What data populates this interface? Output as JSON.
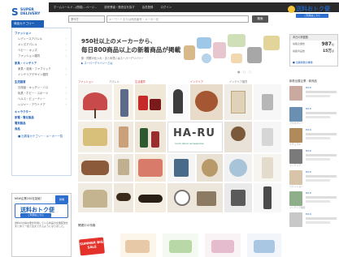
{
  "header": {
    "logo_mark": "S",
    "logo_line1": "SUPER",
    "logo_line2": "DELIVERY",
    "top_links": [
      "ホームシールド…(簡易)…ページ…",
      "卸売業者・販売店を探す",
      "会員登録",
      "ログイン"
    ],
    "search_select": "すべて",
    "search_placeholder": "キーワードまたは商品番号・メーカー名",
    "search_button": "検索"
  },
  "sidebar": {
    "header": "商品カテゴリー",
    "sections": [
      {
        "title": "ファッション",
        "items": [
          "レディースアパレル",
          "メンズアパレル",
          "ベビー・キッズ",
          "ファッション雑貨"
        ]
      },
      {
        "title": "家具・インテリア",
        "items": [
          "家具・収納・ファブリック",
          "インテリアデザイン雑貨"
        ]
      },
      {
        "title": "生活雑貨",
        "items": [
          "日用品・キッチン・バス",
          "玩具・ホビー・スポーツ",
          "ヘルス・ビューティー",
          "レジャー・アウトドア"
        ]
      },
      {
        "title": "キャラクター",
        "items": []
      },
      {
        "title": "家電・電化製品",
        "items": []
      },
      {
        "title": "電気製品",
        "items": []
      },
      {
        "title": "食品",
        "items": []
      }
    ],
    "footer_link": "出展者カテゴリー・メーカー一覧"
  },
  "promo": {
    "title": "NEW企業200社突破！",
    "badge": "新規",
    "logo_text": "送料おトク便",
    "logo_sub": "ご利用はこちら",
    "body": "送料のお得な便を利用している商品の全国配送をまとめて一括で注文できるようになりました。"
  },
  "hero": {
    "headline1": "950社以上のメーカーから、",
    "headline2": "毎日800商品以上の新着商品が掲載",
    "sub": "卸・問屋の仕入れ・まとめ買いはスーパーデリバリー",
    "link": "スーパーデリバリーとは"
  },
  "grid_labels": [
    "ファッション",
    "アパレル",
    "生活雑貨",
    "インテリア",
    "インテリア雑貨"
  ],
  "haru_text": "HA-RU",
  "haru_sub": "room decor accessories",
  "related_title": "関連中の特集",
  "summer_sale": "SUMMER BIG SALE",
  "right": {
    "logo_text": "送料おトク便",
    "logo_sub": "ご利用はこちら",
    "stats_title": "本日の掲載数",
    "stat1_label": "掲載企業数",
    "stat1_value": "987",
    "stat1_unit": "社",
    "stat2_label": "掲載商品数",
    "stat2_value": "15万",
    "stat2_unit": "点",
    "stats_link": "出展者数の推移",
    "new_title": "新着出展企業・新商品",
    "items": [
      {
        "date": "8/19",
        "cap": ""
      },
      {
        "date": "8/19",
        "cap": "アクセサリー"
      },
      {
        "date": "8/19",
        "cap": "ナチュラル"
      },
      {
        "date": "8/19",
        "cap": "インテリア"
      },
      {
        "date": "8/19",
        "cap": "ファッション"
      },
      {
        "date": "8/19",
        "cap": "インテリア雑貨"
      },
      {
        "date": "8/19",
        "cap": ""
      }
    ]
  },
  "colors": {
    "brand_blue": "#1f5fb5",
    "accent_red": "#d23b3b",
    "sale_red": "#e4322b"
  }
}
